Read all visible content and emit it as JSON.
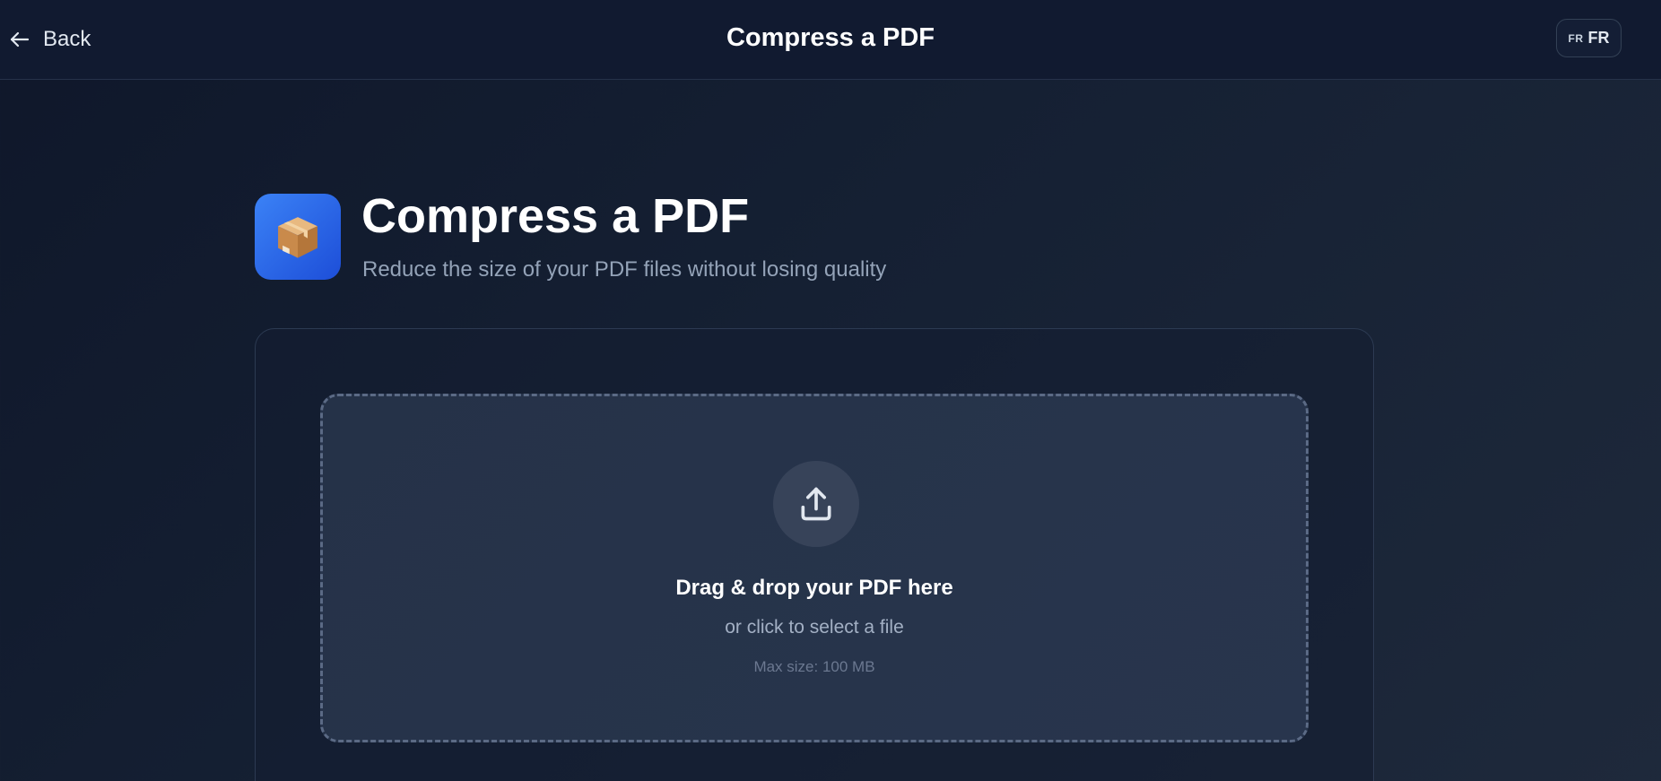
{
  "header": {
    "back_label": "Back",
    "title": "Compress a PDF",
    "language": {
      "flag": "FR",
      "label": "FR"
    }
  },
  "tool": {
    "icon": "package-box-icon",
    "title": "Compress a PDF",
    "subtitle": "Reduce the size of your PDF files without losing quality",
    "accent_color": "#3b82f6"
  },
  "dropzone": {
    "icon": "upload-icon",
    "title": "Drag & drop your PDF here",
    "subtitle": "or click to select a file",
    "max_size": "Max size: 100 MB"
  }
}
